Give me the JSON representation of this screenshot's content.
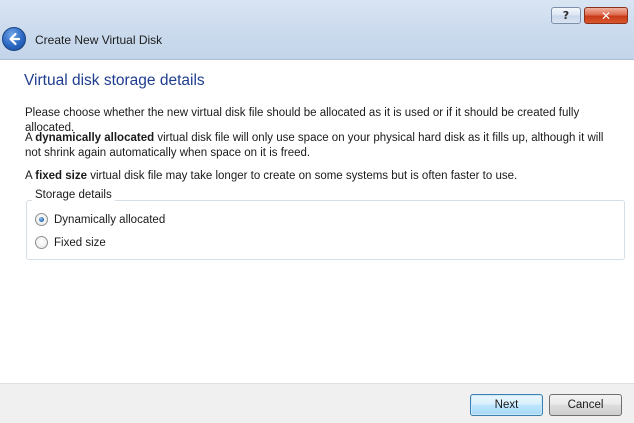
{
  "window": {
    "title": "Create New Virtual Disk",
    "help_label": "?",
    "close_label": "✕"
  },
  "page": {
    "heading": "Virtual disk storage details",
    "intro": "Please choose whether the new virtual disk file should be allocated as it is used or if it should be created fully allocated.",
    "dynamic_prefix": "A ",
    "dynamic_bold": "dynamically allocated",
    "dynamic_rest": " virtual disk file will only use space on your physical hard disk as it fills up, although it will not shrink again automatically when space on it is freed.",
    "fixed_prefix": "A ",
    "fixed_bold": "fixed size",
    "fixed_rest": " virtual disk file may take longer to create on some systems but is often faster to use."
  },
  "storage": {
    "legend": "Storage details",
    "options": [
      {
        "label": "Dynamically allocated",
        "checked": true
      },
      {
        "label": "Fixed size",
        "checked": false
      }
    ]
  },
  "footer": {
    "next_label": "Next",
    "cancel_label": "Cancel"
  }
}
